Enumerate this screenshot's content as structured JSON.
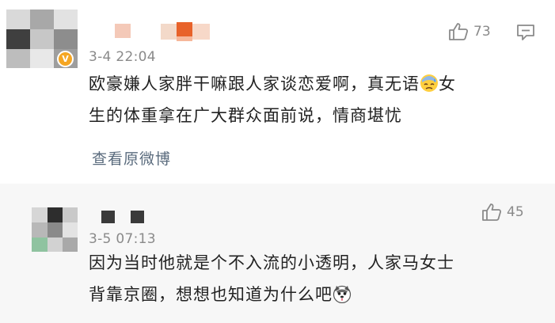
{
  "comments": [
    {
      "timestamp": "3-4 22:04",
      "likes": "73",
      "text_line1": "欧豪嫌人家胖干嘛跟人家谈恋爱啊，真无语",
      "text_line1_tail": "女",
      "text_line2": "生的体重拿在广大群众面前说，情商堪忧",
      "link": "查看原微博",
      "verified": true,
      "emoji": "sweat-face-emoji"
    },
    {
      "timestamp": "3-5 07:13",
      "likes": "45",
      "text_line1": "因为当时他就是个不入流的小透明，人家马女士",
      "text_line2": "背靠京圈，想想也知道为什么吧",
      "emoji": "husky-dog-emoji"
    }
  ],
  "icons": {
    "like": "thumbs-up-icon",
    "reply": "comment-icon",
    "verified": "verified-v-badge"
  },
  "colors": {
    "text": "#222222",
    "meta": "#8a8a8a",
    "link": "#5a6b7d",
    "verified": "#f5a623",
    "second_bg": "#f7f7f7"
  }
}
